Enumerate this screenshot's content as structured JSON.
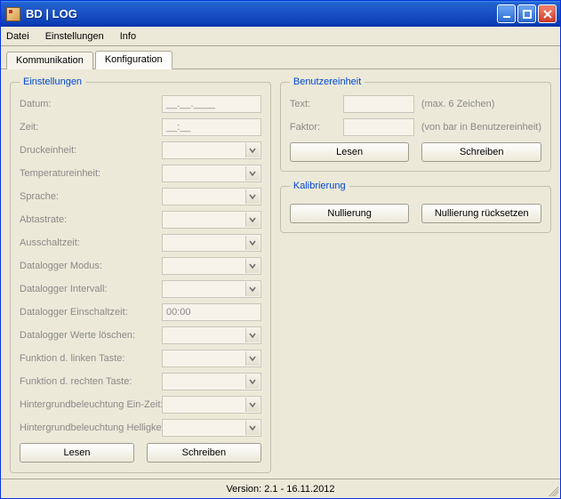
{
  "window": {
    "title": "BD | LOG"
  },
  "menu": {
    "file": "Datei",
    "settings": "Einstellungen",
    "info": "Info"
  },
  "tabs": {
    "communication": "Kommunikation",
    "configuration": "Konfiguration"
  },
  "groups": {
    "settings": "Einstellungen",
    "userunit": "Benutzereinheit",
    "calibration": "Kalibrierung"
  },
  "settings": {
    "fields": {
      "date": {
        "label": "Datum:",
        "value": "__.__.____",
        "type": "text"
      },
      "time": {
        "label": "Zeit:",
        "value": "__:__",
        "type": "text"
      },
      "pressure_unit": {
        "label": "Druckeinheit:",
        "value": "",
        "type": "combo"
      },
      "temp_unit": {
        "label": "Temperatureinheit:",
        "value": "",
        "type": "combo"
      },
      "language": {
        "label": "Sprache:",
        "value": "",
        "type": "combo"
      },
      "sample_rate": {
        "label": "Abtastrate:",
        "value": "",
        "type": "combo"
      },
      "auto_off": {
        "label": "Ausschaltzeit:",
        "value": "",
        "type": "combo"
      },
      "dl_mode": {
        "label": "Datalogger Modus:",
        "value": "",
        "type": "combo"
      },
      "dl_interval": {
        "label": "Datalogger Intervall:",
        "value": "",
        "type": "combo"
      },
      "dl_on_time": {
        "label": "Datalogger Einschaltzeit:",
        "value": "00:00",
        "type": "text"
      },
      "dl_clear": {
        "label": "Datalogger Werte löschen:",
        "value": "",
        "type": "combo"
      },
      "fn_left": {
        "label": "Funktion d. linken Taste:",
        "value": "",
        "type": "combo"
      },
      "fn_right": {
        "label": "Funktion d. rechten Taste:",
        "value": "",
        "type": "combo"
      },
      "backlight_on": {
        "label": "Hintergrundbeleuchtung Ein-Zeit:",
        "value": "",
        "type": "combo"
      },
      "backlight_bright": {
        "label": "Hintergrundbeleuchtung Helligkeit:",
        "value": "",
        "type": "combo"
      }
    },
    "buttons": {
      "read": "Lesen",
      "write": "Schreiben"
    }
  },
  "userunit": {
    "text": {
      "label": "Text:",
      "value": "",
      "hint": "(max. 6 Zeichen)"
    },
    "factor": {
      "label": "Faktor:",
      "value": "",
      "hint": "(von bar in Benutzereinheit)"
    },
    "buttons": {
      "read": "Lesen",
      "write": "Schreiben"
    }
  },
  "calibration": {
    "buttons": {
      "zero": "Nullierung",
      "zero_reset": "Nullierung rücksetzen"
    }
  },
  "status": {
    "version": "Version: 2.1 - 16.11.2012"
  }
}
